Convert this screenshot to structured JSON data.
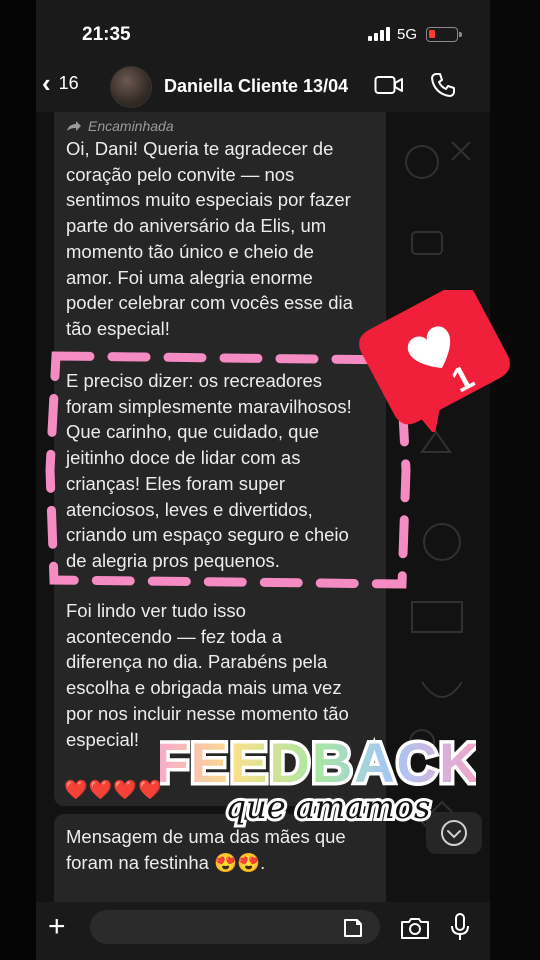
{
  "status_bar": {
    "time": "21:35",
    "network": "5G"
  },
  "header": {
    "back_count": "16",
    "contact_name": "Daniella Cliente 13/04"
  },
  "message": {
    "forwarded_label": "Encaminhada",
    "paragraph_1": "Oi, Dani! Queria te agradecer de\ncoração pelo convite — nos\nsentimos muito especiais por fazer\nparte do aniversário da Elis, um\nmomento tão único e cheio de\namor. Foi uma alegria enorme\npoder celebrar com vocês esse dia\ntão especial!",
    "paragraph_2": "E preciso dizer: os recreadores\nforam simplesmente maravilhosos!\nQue carinho, que cuidado, que\njeitinho doce de lidar com as\ncrianças! Eles foram super\natenciosos, leves e divertidos,\ncriando um espaço seguro e cheio\nde alegria pros pequenos.",
    "paragraph_3": "Foi lindo ver tudo isso\nacontecendo — fez toda a\ndiferença no dia. Parabéns pela\nescolha e obrigada mais uma vez\npor nos incluir nesse momento tão\nespecial!",
    "hearts": "❤️❤️❤️❤️"
  },
  "caption_message": {
    "text": "Mensagem de uma das mães que\nforam na festinha 😍😍."
  },
  "like_badge": {
    "count": "1",
    "color": "#f0203a"
  },
  "sticker": {
    "title": "FEEDBACK",
    "subtitle": "que amamos"
  },
  "icons": {
    "back": "chevron-left-icon",
    "video": "video-camera-icon",
    "phone": "phone-icon",
    "forward": "forward-arrow-icon",
    "scroll": "chevron-down-circle-icon",
    "plus": "plus-icon",
    "sticker": "sticker-icon",
    "camera": "camera-icon",
    "mic": "microphone-icon",
    "heart": "heart-icon"
  },
  "colors": {
    "accent_pink": "#f58bc3",
    "badge_red": "#f0203a"
  }
}
